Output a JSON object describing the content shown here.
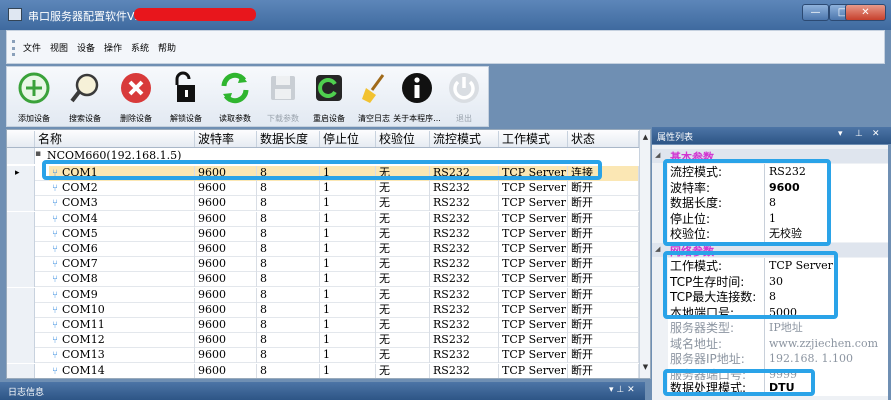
{
  "window": {
    "title": "串口服务器配置软件V2.12"
  },
  "menu": [
    "文件",
    "视图",
    "设备",
    "操作",
    "系统",
    "帮助"
  ],
  "toolbar": [
    {
      "label": "添加设备",
      "icon": "add-icon"
    },
    {
      "label": "搜索设备",
      "icon": "search-icon"
    },
    {
      "label": "删除设备",
      "icon": "delete-icon"
    },
    {
      "label": "解锁设备",
      "icon": "unlock-icon"
    },
    {
      "label": "读取参数",
      "icon": "read-params-icon"
    },
    {
      "label": "下载参数",
      "icon": "save-icon"
    },
    {
      "label": "重启设备",
      "icon": "restart-icon"
    },
    {
      "label": "清空日志",
      "icon": "broom-icon"
    },
    {
      "label": "关于本程序...",
      "icon": "info-icon"
    },
    {
      "label": "退出",
      "icon": "power-icon"
    }
  ],
  "grid": {
    "columns": [
      "名称",
      "波特率",
      "数据长度",
      "停止位",
      "校验位",
      "流控模式",
      "工作模式",
      "状态"
    ],
    "group": "NCOM660(192.168.1.5)",
    "rows": [
      [
        "COM1",
        "9600",
        "8",
        "1",
        "无",
        "RS232",
        "TCP Server",
        "连接"
      ],
      [
        "COM2",
        "9600",
        "8",
        "1",
        "无",
        "RS232",
        "TCP Server",
        "断开"
      ],
      [
        "COM3",
        "9600",
        "8",
        "1",
        "无",
        "RS232",
        "TCP Server",
        "断开"
      ],
      [
        "COM4",
        "9600",
        "8",
        "1",
        "无",
        "RS232",
        "TCP Server",
        "断开"
      ],
      [
        "COM5",
        "9600",
        "8",
        "1",
        "无",
        "RS232",
        "TCP Server",
        "断开"
      ],
      [
        "COM6",
        "9600",
        "8",
        "1",
        "无",
        "RS232",
        "TCP Server",
        "断开"
      ],
      [
        "COM7",
        "9600",
        "8",
        "1",
        "无",
        "RS232",
        "TCP Server",
        "断开"
      ],
      [
        "COM8",
        "9600",
        "8",
        "1",
        "无",
        "RS232",
        "TCP Server",
        "断开"
      ],
      [
        "COM9",
        "9600",
        "8",
        "1",
        "无",
        "RS232",
        "TCP Server",
        "断开"
      ],
      [
        "COM10",
        "9600",
        "8",
        "1",
        "无",
        "RS232",
        "TCP Server",
        "断开"
      ],
      [
        "COM11",
        "9600",
        "8",
        "1",
        "无",
        "RS232",
        "TCP Server",
        "断开"
      ],
      [
        "COM12",
        "9600",
        "8",
        "1",
        "无",
        "RS232",
        "TCP Server",
        "断开"
      ],
      [
        "COM13",
        "9600",
        "8",
        "1",
        "无",
        "RS232",
        "TCP Server",
        "断开"
      ],
      [
        "COM14",
        "9600",
        "8",
        "1",
        "无",
        "RS232",
        "TCP Server",
        "断开"
      ]
    ]
  },
  "log": {
    "title": "日志信息"
  },
  "properties": {
    "title": "属性列表",
    "categories": [
      {
        "name": "基本参数",
        "items": [
          {
            "key": "流控模式:",
            "value": "RS232"
          },
          {
            "key": "波特率:",
            "value": "9600"
          },
          {
            "key": "数据长度:",
            "value": "8"
          },
          {
            "key": "停止位:",
            "value": "1"
          },
          {
            "key": "校验位:",
            "value": "无校验"
          }
        ]
      },
      {
        "name": "网络参数",
        "items": [
          {
            "key": "工作模式:",
            "value": "TCP Server"
          },
          {
            "key": "TCP生存时间:",
            "value": "30"
          },
          {
            "key": "TCP最大连接数:",
            "value": "8"
          },
          {
            "key": "本地端口号:",
            "value": "5000"
          },
          {
            "key": "服务器类型:",
            "value": "IP地址"
          },
          {
            "key": "域名地址:",
            "value": "www.zzjiechen.com"
          },
          {
            "key": "服务器IP地址:",
            "value": "192.168.  1.100"
          },
          {
            "key": "服务器端口号:",
            "value": "9999"
          },
          {
            "key": "数据处理模式:",
            "value": "DTU"
          }
        ]
      }
    ]
  },
  "colors": {
    "highlight": "#2aa3e8",
    "selected_row": "#fbe7b4",
    "category_text": "#d136d1"
  }
}
